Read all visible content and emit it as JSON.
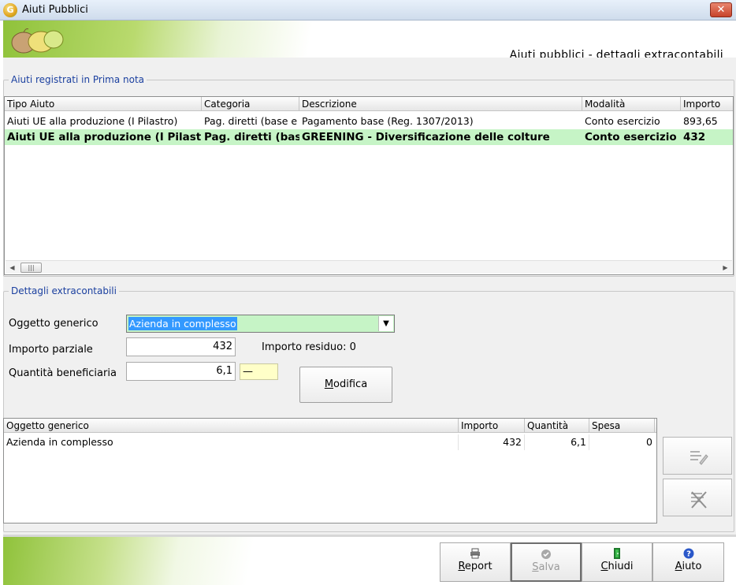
{
  "window": {
    "title": "Aiuti Pubblici",
    "icon_letter": "G",
    "close_glyph": "✕"
  },
  "banner": {
    "subtitle": "Aiuti pubblici - dettagli extracontabili"
  },
  "registered_group": {
    "legend": "Aiuti registrati in Prima nota",
    "columns": [
      "Tipo Aiuto",
      "Categoria",
      "Descrizione",
      "Modalità",
      "Importo"
    ],
    "rows": [
      {
        "tipo": "Aiuti UE alla produzione (I Pilastro)",
        "categoria": "Pag. diretti (base e",
        "descrizione": "Pagamento base (Reg. 1307/2013)",
        "modalita": "Conto esercizio",
        "importo": "893,65",
        "selected": false
      },
      {
        "tipo": "Aiuti UE alla produzione (I Pilastro)",
        "categoria": "Pag. diretti (base",
        "descrizione": "GREENING - Diversificazione delle colture",
        "modalita": "Conto esercizio",
        "importo": "432",
        "selected": true
      }
    ],
    "scroll": {
      "left": "◀",
      "thumb": "|||",
      "right": "▶"
    }
  },
  "details_group": {
    "legend": "Dettagli extracontabili",
    "oggetto_label": "Oggetto generico",
    "oggetto_value": "Azienda in complesso",
    "combo_arrow": "▼",
    "importo_label": "Importo parziale",
    "importo_value": "432",
    "residuo_text": "Importo residuo: 0",
    "quantita_label": "Quantità beneficiaria",
    "quantita_value": "6,1",
    "unit_value": "—",
    "modifica_label": "Modifica",
    "modifica_key": "M",
    "columns": [
      "Oggetto generico",
      "Importo",
      "Quantità",
      "Spesa"
    ],
    "rows": [
      {
        "oggetto": "Azienda in complesso",
        "importo": "432",
        "quantita": "6,1",
        "spesa": "0"
      }
    ]
  },
  "footer": {
    "buttons": [
      {
        "key": "R",
        "rest": "eport",
        "enabled": true
      },
      {
        "key": "S",
        "rest": "alva",
        "enabled": false
      },
      {
        "key": "C",
        "rest": "hiudi",
        "enabled": true
      },
      {
        "key": "A",
        "rest": "iuto",
        "enabled": true
      }
    ]
  },
  "colors": {
    "selected_row": "#c6f4c6",
    "legend_text": "#1a3f9f",
    "selection_blue": "#3399ff"
  }
}
